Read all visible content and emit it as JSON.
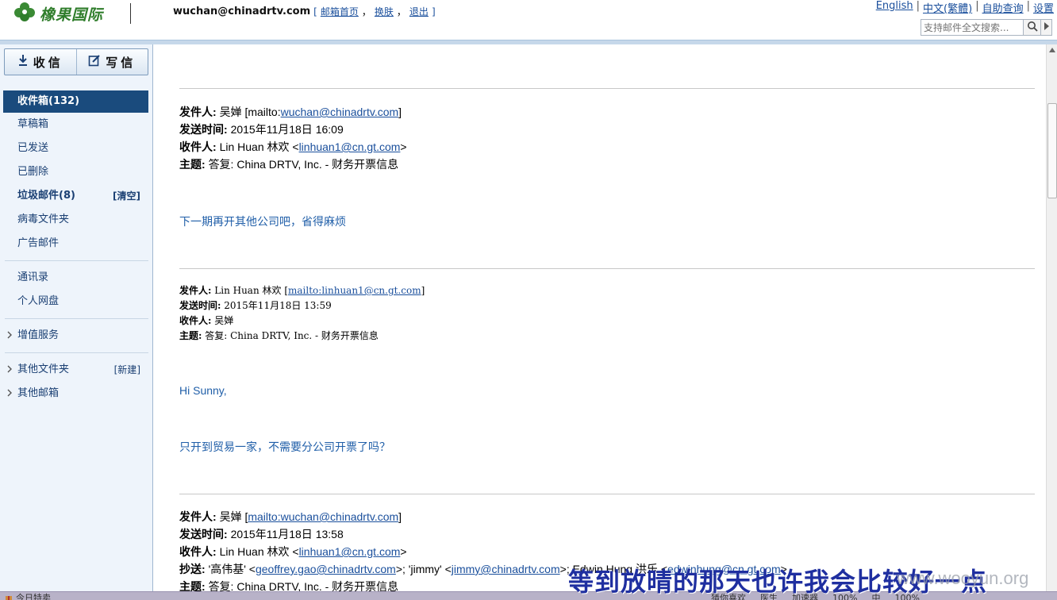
{
  "header": {
    "logo_text": "橡果国际",
    "account_email": "wuchan@chinadrtv.com",
    "bracket_open": "[",
    "bracket_close": "]",
    "links": [
      "邮箱首页",
      "换肤",
      "退出"
    ],
    "link_sep": "，",
    "top_links": [
      "English",
      "中文(繁體)",
      "自助查询",
      "设置"
    ],
    "top_sep": "|",
    "search_placeholder": "支持邮件全文搜索..."
  },
  "sidebar": {
    "receive_label": "收信",
    "compose_label": "写信",
    "folders": [
      {
        "label": "收件箱(132)"
      },
      {
        "label": "草稿箱"
      },
      {
        "label": "已发送"
      },
      {
        "label": "已删除"
      },
      {
        "label": "垃圾邮件(8)",
        "action": "清空"
      },
      {
        "label": "病毒文件夹"
      },
      {
        "label": "广告邮件"
      }
    ],
    "tools": [
      {
        "label": "通讯录"
      },
      {
        "label": "个人网盘"
      }
    ],
    "services": {
      "label": "增值服务"
    },
    "other_folders": {
      "label": "其他文件夹",
      "action": "新建"
    },
    "other_mailbox": {
      "label": "其他邮箱"
    },
    "bracket_open": "[",
    "bracket_close": "]"
  },
  "messages": [
    {
      "from_label": "发件人:",
      "from_name": "吴婵",
      "from_prefix": "[mailto:",
      "from_link": "wuchan@chinadrtv.com",
      "from_suffix": "]",
      "sent_label": "发送时间:",
      "sent": "2015年11月18日 16:09",
      "to_label": "收件人:",
      "to_name": "Lin Huan 林欢 <",
      "to_link": "linhuan1@cn.gt.com",
      "to_suffix": ">",
      "subject_label": "主题:",
      "subject": "答复: China DRTV, Inc. - 财务开票信息",
      "body": [
        "下一期再开其他公司吧，省得麻烦"
      ]
    },
    {
      "from_label": "发件人:",
      "from_name": "Lin Huan 林欢 [",
      "from_link": "mailto:linhuan1@cn.gt.com",
      "from_suffix": "]",
      "sent_label": "发送时间:",
      "sent": "2015年11月18日 13:59",
      "to_label": "收件人:",
      "to_name": "吴婵",
      "subject_label": "主题:",
      "subject": "答复: China DRTV, Inc. - 财务开票信息",
      "body": [
        "Hi Sunny,",
        "只开到贸易一家，不需要分公司开票了吗？"
      ]
    },
    {
      "from_label": "发件人:",
      "from_name": "吴婵 [",
      "from_link": "mailto:wuchan@chinadrtv.com",
      "from_suffix": "]",
      "sent_label": "发送时间:",
      "sent": "2015年11月18日 13:58",
      "to_label": "收件人:",
      "to_name": "Lin Huan 林欢 <",
      "to_link": "linhuan1@cn.gt.com",
      "to_suffix": ">",
      "cc_label": "抄送:",
      "cc_1_name": "'高伟基' <",
      "cc_1_link": "geoffrey.gao@chinadrtv.com",
      "cc_2_name": ">; 'jimmy' <",
      "cc_2_link": "jimmy@chinadrtv.com",
      "cc_3_name": ">; Edwin Hung 洪乐 <",
      "cc_3_link": "edwinhung@cn.gt.com",
      "cc_suffix": ">",
      "subject_label": "主题:",
      "subject": "答复: China DRTV, Inc. - 财务开票信息"
    }
  ],
  "statusbar": {
    "left": "今日特卖",
    "right": [
      "猜你喜欢",
      "医生",
      "加速器",
      "100%",
      "中",
      "100%"
    ]
  },
  "watermark": {
    "text": "等到放晴的那天也许我会比较好一点",
    "url": "www.wooyun.org"
  },
  "colors": {
    "sidebar_bg": "#eef4fb",
    "active_folder": "#1a4b7d",
    "link": "#1a4f9c",
    "body_text": "#1f5ea8",
    "logo": "#2f7d2b"
  }
}
